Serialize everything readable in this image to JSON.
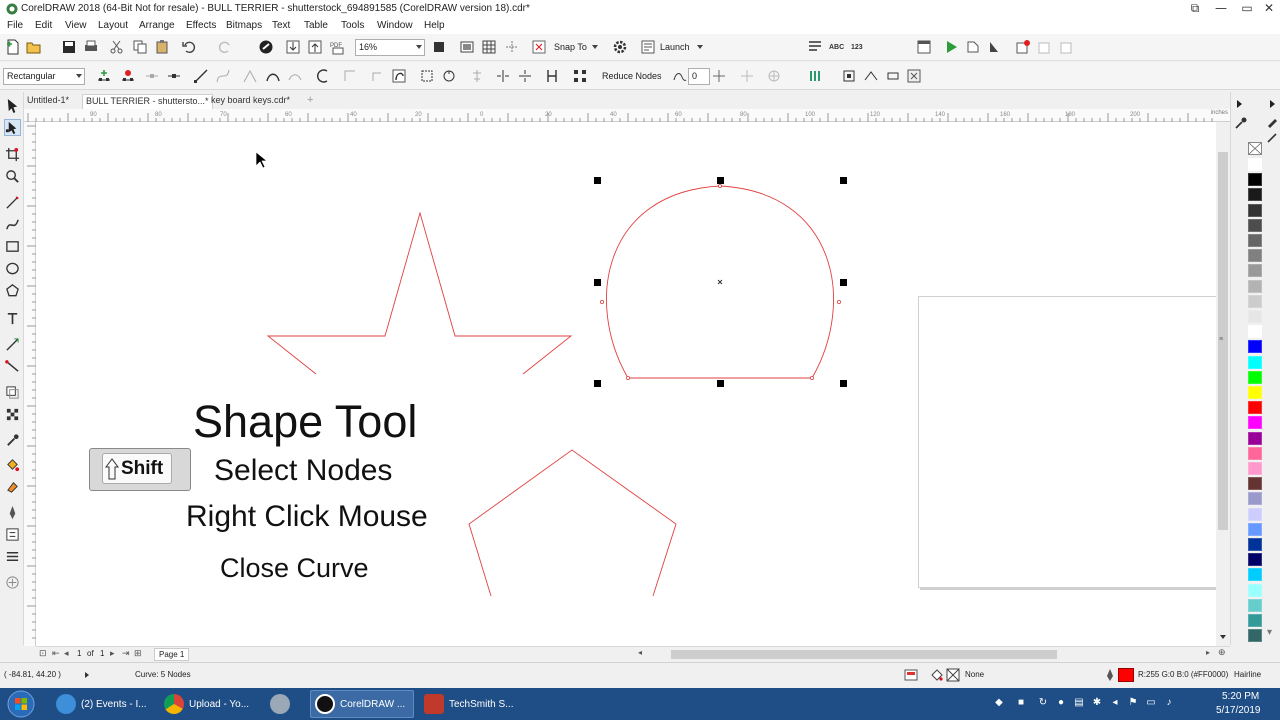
{
  "window": {
    "title": "CorelDRAW 2018 (64-Bit Not for resale) - BULL TERRIER - shutterstock_694891585 (CorelDRAW version 18).cdr*",
    "min_glyph": "—",
    "max_glyph": "▭",
    "close_glyph": "✕"
  },
  "menu": [
    "File",
    "Edit",
    "View",
    "Layout",
    "Arrange",
    "Effects",
    "Bitmaps",
    "Text",
    "Table",
    "Tools",
    "Window",
    "Help"
  ],
  "standard_toolbar": {
    "zoom_value": "16%",
    "snap_to_label": "Snap To",
    "launch_label": "Launch"
  },
  "property_bar": {
    "selection_mode": "Rectangular",
    "reduce_nodes_label": "Reduce Nodes",
    "curve_smoothness_value": "0"
  },
  "tabs": [
    {
      "label": "Untitled-1*",
      "active": false
    },
    {
      "label": "BULL TERRIER - shuttersto...*",
      "active": true
    },
    {
      "label": "key board keys.cdr*",
      "active": false
    }
  ],
  "ruler_units": "inches",
  "ruler_ticks": [
    "90",
    "80",
    "70",
    "60",
    "40",
    "20",
    "0",
    "20",
    "40",
    "60",
    "80",
    "100",
    "120",
    "140",
    "160",
    "180",
    "200"
  ],
  "canvas": {
    "title": "Shape Tool",
    "shift_key": "Shift",
    "step1": "Select Nodes",
    "step2": "Right Click Mouse",
    "step3": "Close Curve",
    "outline_color": "#e04040"
  },
  "page_nav": {
    "current": "1",
    "of_label": "of",
    "total": "1",
    "page_tab": "Page 1"
  },
  "status": {
    "coordinates": "( -84.81, 44.20 )",
    "selection_info": "Curve: 5 Nodes",
    "fill_label": "None",
    "outline_info": "R:255 G:0 B:0 (#FF0000)",
    "outline_width": "Hairline"
  },
  "palette": [
    "#ffffff",
    "#000000",
    "#1a1a1a",
    "#333333",
    "#4d4d4d",
    "#666666",
    "#808080",
    "#999999",
    "#b3b3b3",
    "#cccccc",
    "#e6e6e6",
    "#ffffff",
    "#0000ff",
    "#00ffff",
    "#00ff00",
    "#ffff00",
    "#ff0000",
    "#ff00ff",
    "#990099",
    "#ff6699",
    "#ff99cc",
    "#663333",
    "#9999cc",
    "#ccccff",
    "#6699ff",
    "#003399",
    "#000066",
    "#00ccff",
    "#99ffff",
    "#66cccc",
    "#339999",
    "#336666"
  ],
  "taskbar": {
    "items": [
      {
        "label": "(2) Events - I...",
        "color": "#3c8fd8"
      },
      {
        "label": "Upload - Yo...",
        "color": "#e8a317"
      },
      {
        "label": "",
        "color": "#9aa8b8"
      },
      {
        "label": "CorelDRAW ...",
        "color": "#111111",
        "active": true
      },
      {
        "label": "TechSmith S...",
        "color": "#c0392b"
      }
    ],
    "time": "5:20 PM",
    "date": "5/17/2019"
  }
}
